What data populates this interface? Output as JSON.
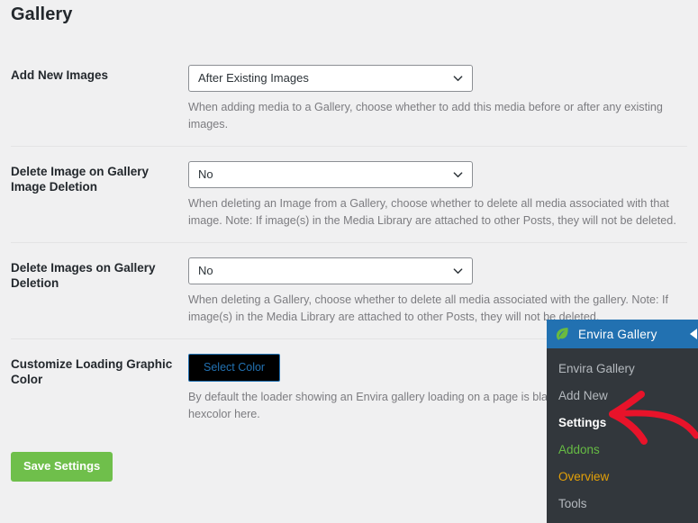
{
  "page": {
    "title": "Gallery"
  },
  "settings": {
    "rows": [
      {
        "label": "Add New Images",
        "control": "select",
        "value": "After Existing Images",
        "description": "When adding media to a Gallery, choose whether to add this media before or after any existing images."
      },
      {
        "label": "Delete Image on Gallery Image Deletion",
        "control": "select",
        "value": "No",
        "description": "When deleting an Image from a Gallery, choose whether to delete all media associated with that image. Note: If image(s) in the Media Library are attached to other Posts, they will not be deleted."
      },
      {
        "label": "Delete Images on Gallery Deletion",
        "control": "select",
        "value": "No",
        "description": "When deleting a Gallery, choose whether to delete all media associated with the gallery. Note: If image(s) in the Media Library are attached to other Posts, they will not be deleted."
      },
      {
        "label": "Customize Loading Graphic Color",
        "control": "color-button",
        "value": "Select Color",
        "description": "By default the loader showing an Envira gallery loading on a page is black (#0 by entering a hexcolor here."
      }
    ],
    "save_label": "Save Settings"
  },
  "admin_menu": {
    "icon": "leaf-icon",
    "title": "Envira Gallery",
    "collapse_icon": "collapse-arrow-icon",
    "items": [
      {
        "label": "Envira Gallery",
        "state": "default"
      },
      {
        "label": "Add New",
        "state": "default"
      },
      {
        "label": "Settings",
        "state": "current"
      },
      {
        "label": "Addons",
        "state": "addons"
      },
      {
        "label": "Overview",
        "state": "overview"
      },
      {
        "label": "Tools",
        "state": "default"
      }
    ]
  },
  "annotation": {
    "name": "red-arrow-pointing-to-settings",
    "color": "#e8132a"
  },
  "colors": {
    "page_background": "#f0f0f1",
    "menu_header": "#2271b1",
    "menu_background": "#32373c",
    "save_button": "#6fbf4b",
    "addons_text": "#66bb44",
    "overview_text": "#e3a008",
    "color_button_background": "#000000",
    "color_button_text": "#2271b1"
  }
}
